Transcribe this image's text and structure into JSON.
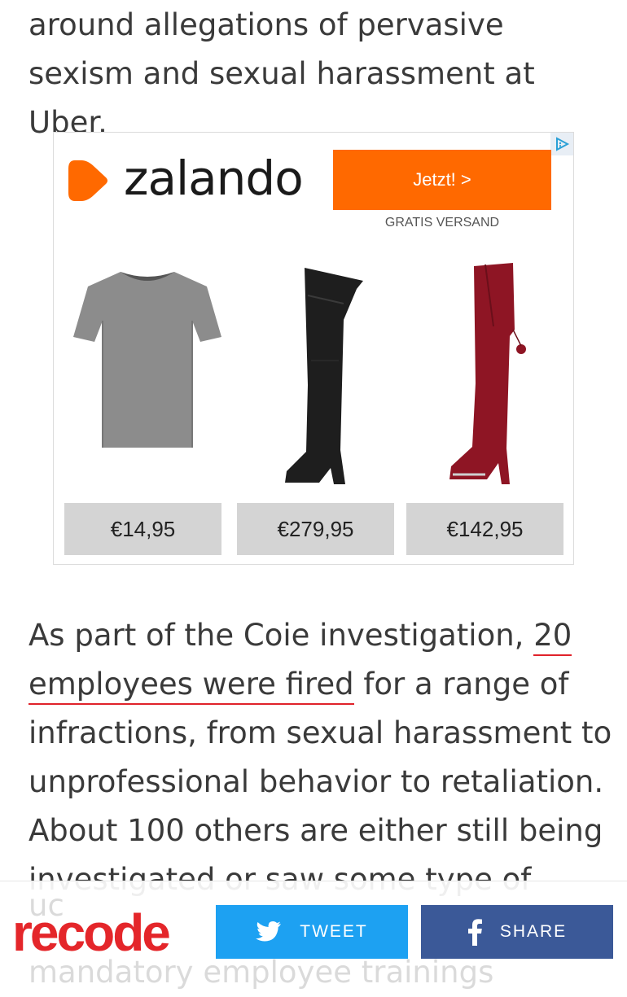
{
  "article": {
    "para_top": "around allegations of pervasive sexism and sexual harassment at Uber.",
    "para_main_before": "As part of the Coie investigation, ",
    "para_main_link": "20 employees were fired",
    "para_main_after": " for a range of infractions, from sexual harassment to unprofessional behavior to retaliation. About 100 others are either still being investigated or saw some type of",
    "ghost_line_1": "investigated or saw some type of",
    "ghost_line_2": "mandatory employee trainings",
    "ghost_fragment": "uc"
  },
  "ad": {
    "brand": "zalando",
    "cta_label": "Jetzt! >",
    "tagline": "GRATIS VERSAND",
    "choices_icon": "adchoices-icon",
    "brand_color": "#ff6900",
    "products": [
      {
        "name": "grey-tshirt",
        "price": "€14,95"
      },
      {
        "name": "black-thigh-boot",
        "price": "€279,95"
      },
      {
        "name": "red-thigh-boot",
        "price": "€142,95"
      }
    ]
  },
  "sharebar": {
    "logo": "recode",
    "tweet_label": "TWEET",
    "share_label": "SHARE",
    "tweet_color": "#1da1f2",
    "share_color": "#3b5998",
    "logo_color": "#e4262a"
  }
}
